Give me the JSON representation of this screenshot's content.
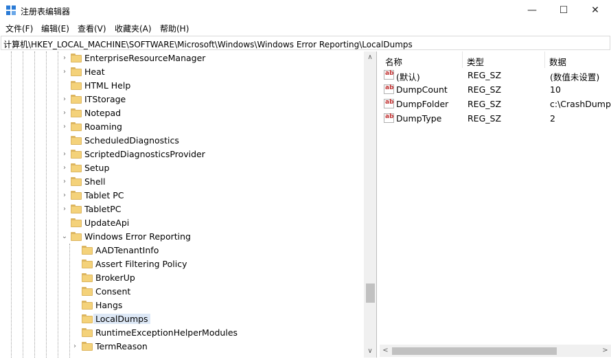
{
  "window": {
    "title": "注册表编辑器",
    "minimize_symbol": "—",
    "maximize_symbol": "☐",
    "close_symbol": "✕"
  },
  "menu": [
    "文件(F)",
    "编辑(E)",
    "查看(V)",
    "收藏夹(A)",
    "帮助(H)"
  ],
  "address": "计算机\\HKEY_LOCAL_MACHINE\\SOFTWARE\\Microsoft\\Windows\\Windows Error Reporting\\LocalDumps",
  "tree": {
    "items": [
      {
        "label": "EnterpriseResourceManager",
        "expander": "›"
      },
      {
        "label": "Heat",
        "expander": "›"
      },
      {
        "label": "HTML Help",
        "expander": ""
      },
      {
        "label": "ITStorage",
        "expander": "›"
      },
      {
        "label": "Notepad",
        "expander": "›"
      },
      {
        "label": "Roaming",
        "expander": "›"
      },
      {
        "label": "ScheduledDiagnostics",
        "expander": ""
      },
      {
        "label": "ScriptedDiagnosticsProvider",
        "expander": "›"
      },
      {
        "label": "Setup",
        "expander": "›"
      },
      {
        "label": "Shell",
        "expander": "›"
      },
      {
        "label": "Tablet PC",
        "expander": "›"
      },
      {
        "label": "TabletPC",
        "expander": "›"
      },
      {
        "label": "UpdateApi",
        "expander": ""
      },
      {
        "label": "Windows Error Reporting",
        "expander": "⌄"
      },
      {
        "label": "AADTenantInfo",
        "expander": ""
      },
      {
        "label": "Assert Filtering Policy",
        "expander": ""
      },
      {
        "label": "BrokerUp",
        "expander": ""
      },
      {
        "label": "Consent",
        "expander": ""
      },
      {
        "label": "Hangs",
        "expander": ""
      },
      {
        "label": "LocalDumps",
        "expander": ""
      },
      {
        "label": "RuntimeExceptionHelperModules",
        "expander": ""
      },
      {
        "label": "TermReason",
        "expander": "›"
      }
    ],
    "selected": "LocalDumps"
  },
  "list": {
    "columns": [
      "名称",
      "类型",
      "数据"
    ],
    "rows": [
      {
        "name": "(默认)",
        "type": "REG_SZ",
        "data": "(数值未设置)",
        "icon": "ab"
      },
      {
        "name": "DumpCount",
        "type": "REG_SZ",
        "data": "10",
        "icon": "ab"
      },
      {
        "name": "DumpFolder",
        "type": "REG_SZ",
        "data": "c:\\CrashDump",
        "icon": "ab"
      },
      {
        "name": "DumpType",
        "type": "REG_SZ",
        "data": "2",
        "icon": "ab"
      }
    ]
  },
  "scroll": {
    "up": "∧",
    "down": "∨",
    "left": "<",
    "right": ">"
  },
  "colors": {
    "folder": "#f4d27a",
    "selection": "#dde8f6",
    "app_icon": "#2b7bd6",
    "reg_icon_text": "#c03030"
  }
}
